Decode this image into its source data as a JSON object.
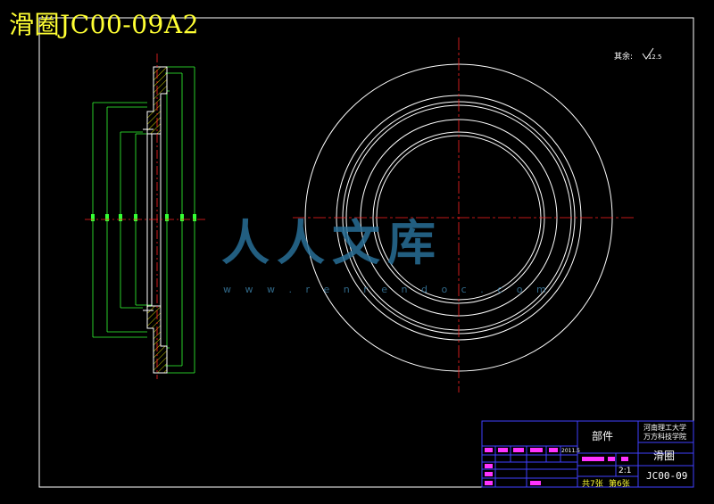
{
  "drawing": {
    "title": "滑圈JC00-09A2",
    "note": "其余:",
    "roughness": "12.5"
  },
  "watermark": {
    "text": "人人文库",
    "url": "w w w . r e n r e n d o c . c o m"
  },
  "title_block": {
    "category": "部件",
    "school_line1": "河南理工大学",
    "school_line2": "万方科技学院",
    "part_name": "滑圈",
    "scale": "2:1",
    "drawing_no": "JC00-09",
    "sheets": "共7张",
    "sheet": "第6张",
    "date": "2011.5"
  },
  "colors": {
    "background": "#000000",
    "outline": "#ffffff",
    "dimension": "#33ff33",
    "centerline": "#ff2222",
    "hatch": "#ffff00",
    "title_text": "#ffff33",
    "table": "#4040ff"
  }
}
